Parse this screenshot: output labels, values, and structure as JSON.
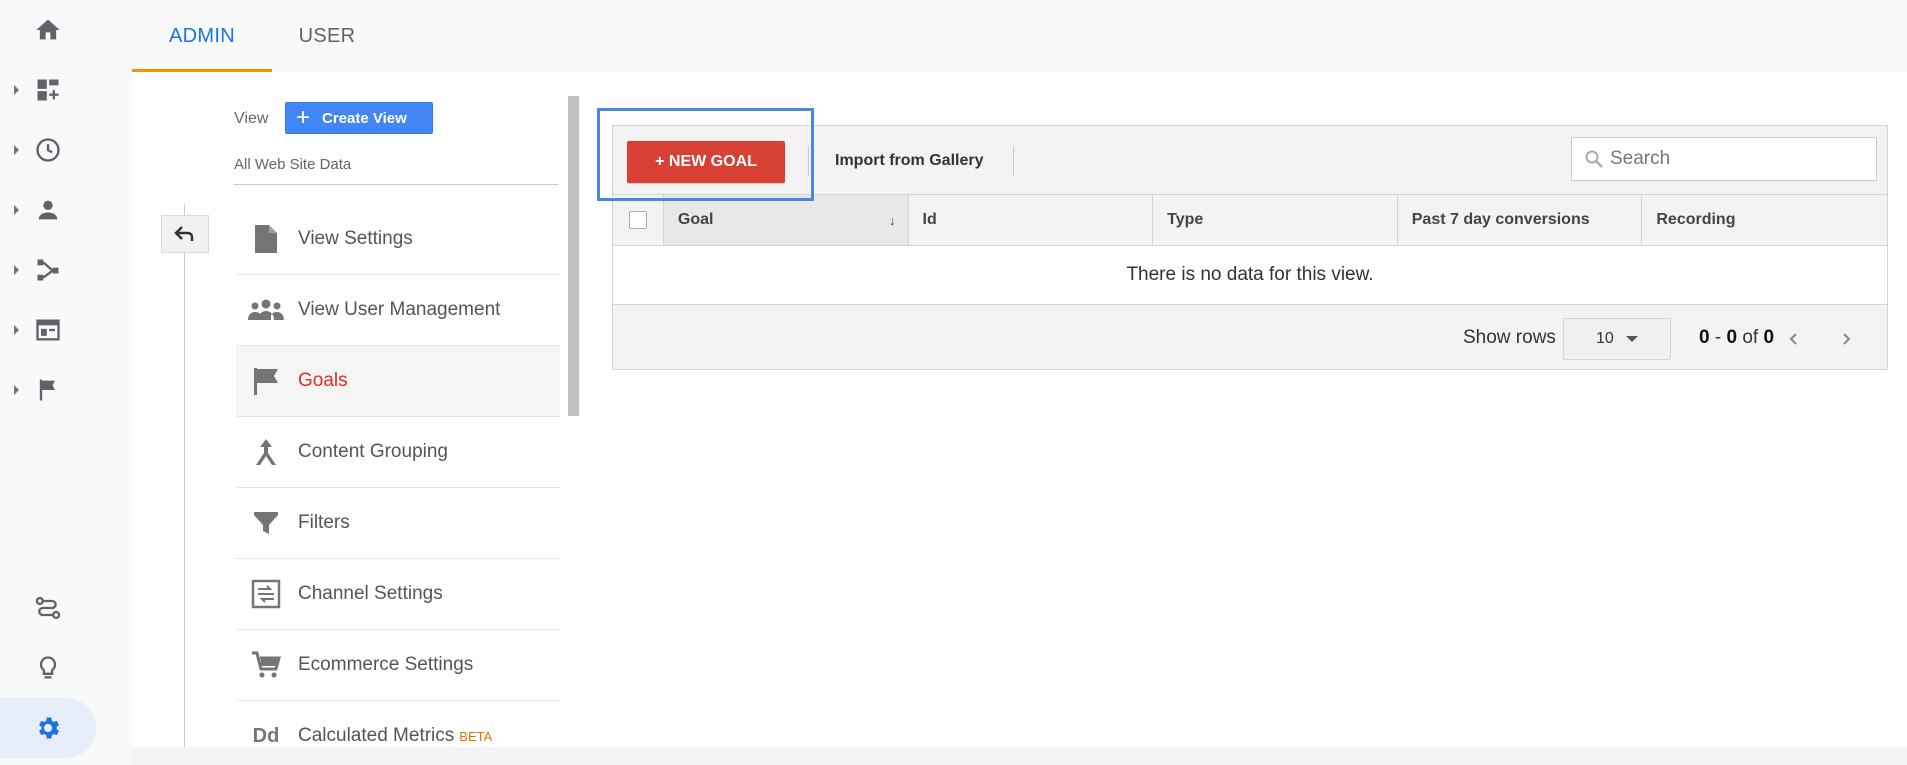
{
  "tabs": {
    "admin": "ADMIN",
    "user": "USER"
  },
  "rail": {
    "items": [
      "home-icon",
      "customization-icon",
      "realtime-icon",
      "audience-icon",
      "acquisition-icon",
      "behavior-icon",
      "conversions-icon"
    ],
    "bottom": [
      "attribution-icon",
      "discover-icon",
      "admin-gear-icon"
    ],
    "active_color": "#1a73e8"
  },
  "view": {
    "label": "View",
    "create_view": "Create View",
    "site_data": "All Web Site Data"
  },
  "menu": {
    "items": [
      {
        "label": "View Settings",
        "icon": "document-icon"
      },
      {
        "label": "View User Management",
        "icon": "users-icon"
      },
      {
        "label": "Goals",
        "icon": "flag-icon"
      },
      {
        "label": "Content Grouping",
        "icon": "grouping-icon"
      },
      {
        "label": "Filters",
        "icon": "filter-icon"
      },
      {
        "label": "Channel Settings",
        "icon": "channel-icon"
      },
      {
        "label": "Ecommerce Settings",
        "icon": "cart-icon"
      },
      {
        "label": "Calculated Metrics",
        "icon": "dd-icon",
        "badge": "BETA"
      }
    ],
    "selected": "Goals"
  },
  "goals": {
    "new_goal": "+ NEW GOAL",
    "import": "Import from Gallery",
    "search_placeholder": "Search",
    "columns": [
      "Goal",
      "Id",
      "Type",
      "Past 7 day conversions",
      "Recording"
    ],
    "sort_indicator": "↓",
    "empty": "There is no data for this view.",
    "show_rows_label": "Show rows",
    "rows_value": "10",
    "range_start": "0",
    "range_sep": " - ",
    "range_end": "0",
    "range_of": " of ",
    "range_total": "0"
  },
  "colors": {
    "new_goal": "#d74032",
    "create_view": "#4285f4",
    "tab_active": "#1a73e8",
    "tab_underline": "#f29900",
    "highlight": "#4a86e8"
  }
}
